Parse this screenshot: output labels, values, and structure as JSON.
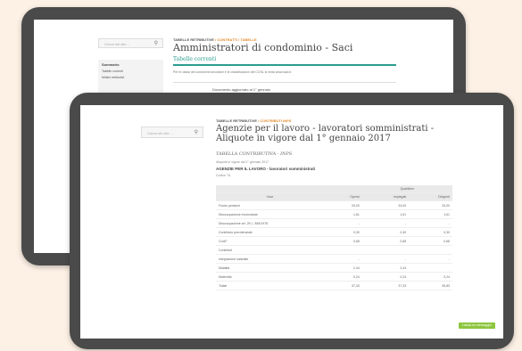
{
  "back": {
    "search_placeholder": "Cerca nel sito ...",
    "breadcrumb": {
      "a": "TABELLE RETRIBUTIVE",
      "sep": "/",
      "b": "CONTRATTI",
      "sep2": "/",
      "c": "TABELLE"
    },
    "title": "Amministratori di condominio - Saci",
    "subtitle": "Tabelle correnti",
    "intro": "Per le classi dei condomini lavoratori e le classificazioni del CCNL si veda www.saci.it.",
    "doc_line": "Documento aggiornato al 1° gennaio",
    "sidebar": {
      "heading": "Sommario",
      "items": [
        "Tabelle correnti",
        "Minimi retributivi"
      ]
    }
  },
  "front": {
    "search_placeholder": "Cerca nel sito ...",
    "breadcrumb": {
      "a": "TABELLE RETRIBUTIVE",
      "sep": "/",
      "b": "CONTRIBUTI INPS"
    },
    "title_line1": "Agenzie per il lavoro - lavoratori somministrati -",
    "title_line2": "Aliquote in vigore dal 1° gennaio 2017",
    "section": "TABELLA CONTRIBUTIVA - INPS",
    "valid_from": "Aliquote in vigore dal 1° gennaio 2017",
    "heading": "AGENZIE PER IL LAVORO - lavoratori somministrati",
    "sub": "Codice 7A",
    "table": {
      "group_header": "Qualifiche",
      "col_headers": [
        "Voce",
        "Operai",
        "Impiegati",
        "Dirigenti"
      ],
      "rows": [
        [
          "Fondo pensioni",
          "33,00",
          "33,00",
          "33,00"
        ],
        [
          "Disoccupazione involontaria",
          "1,61",
          "1,61",
          "1,61"
        ],
        [
          "Disoccupazione art. 25 L. 845/1978",
          "-",
          "-",
          "-"
        ],
        [
          "Contributo previdenziale",
          "0,30",
          "0,30",
          "0,30"
        ],
        [
          "CUAF",
          "0,68",
          "0,68",
          "0,68"
        ],
        [
          "Contributi",
          "",
          "",
          ""
        ],
        [
          "Integrazione salariale",
          "-",
          "-",
          "-"
        ],
        [
          "Malattia",
          "2,44",
          "2,44",
          ""
        ],
        [
          "Maternità",
          "0,24",
          "0,24",
          "0,24"
        ],
        [
          "Totale",
          "37,33",
          "37,33",
          "35,83"
        ]
      ]
    },
    "chat_button": "Lascia un messaggio"
  }
}
